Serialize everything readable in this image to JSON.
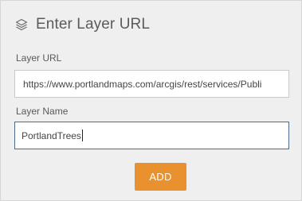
{
  "header": {
    "icon": "layers-icon",
    "title": "Enter Layer URL"
  },
  "layer_url": {
    "label": "Layer URL",
    "value": "https://www.portlandmaps.com/arcgis/rest/services/Publi"
  },
  "layer_name": {
    "label": "Layer Name",
    "value": "PortlandTrees"
  },
  "add_button": {
    "label": "ADD",
    "color": "#e8912e"
  }
}
